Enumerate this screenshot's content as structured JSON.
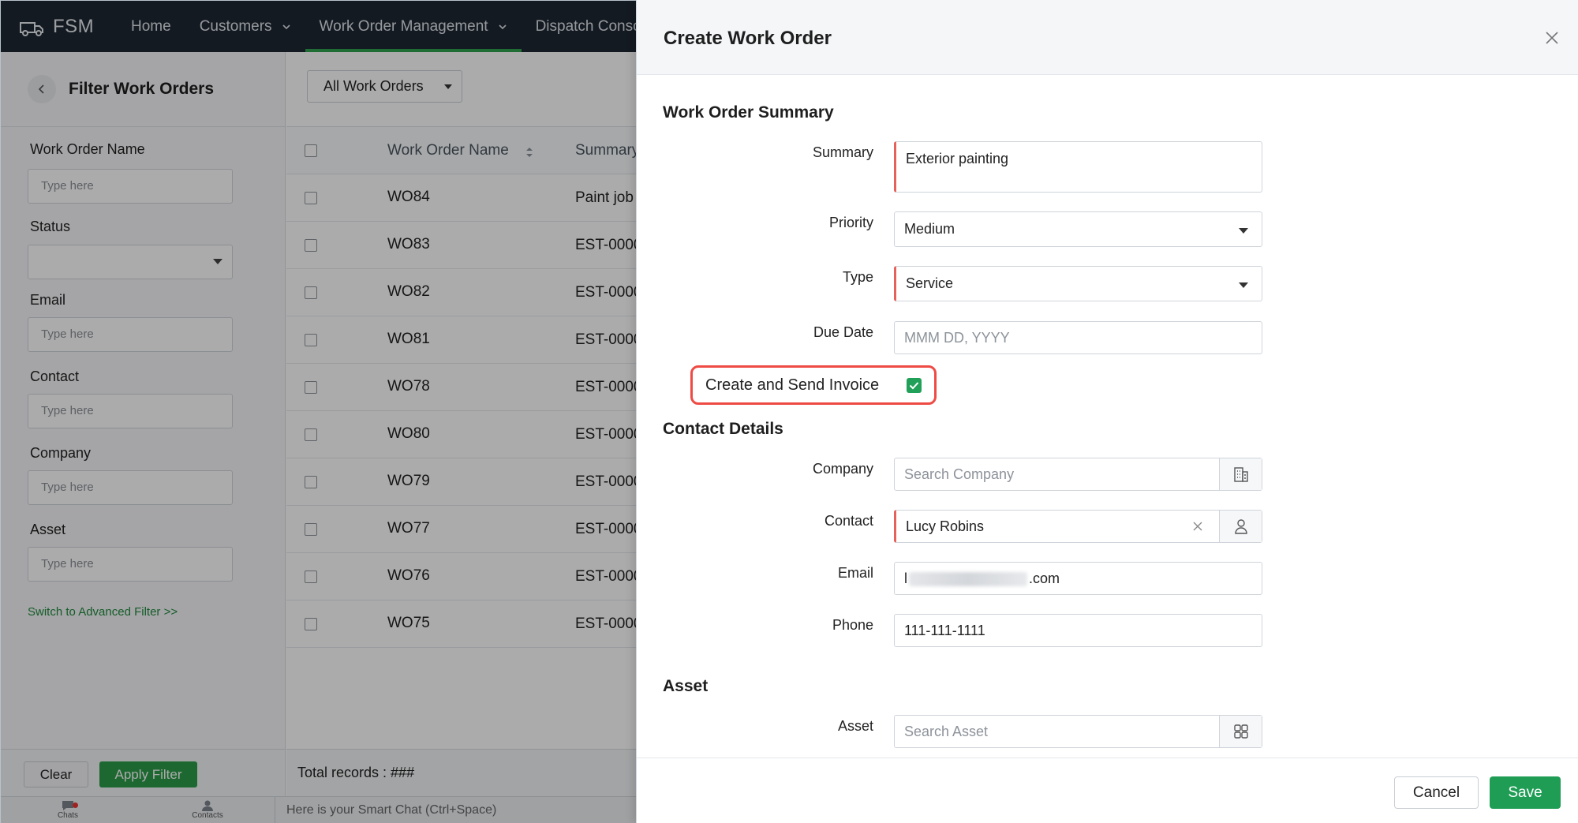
{
  "topnav": {
    "brand": "FSM",
    "items": [
      {
        "label": "Home"
      },
      {
        "label": "Customers"
      },
      {
        "label": "Work Order Management"
      },
      {
        "label": "Dispatch Console"
      }
    ]
  },
  "filter": {
    "title": "Filter Work Orders",
    "fields": [
      {
        "label": "Work Order Name",
        "placeholder": "Type here"
      },
      {
        "label": "Status",
        "value": ""
      },
      {
        "label": "Email",
        "placeholder": "Type here"
      },
      {
        "label": "Contact",
        "placeholder": "Type here"
      },
      {
        "label": "Company",
        "placeholder": "Type here"
      },
      {
        "label": "Asset",
        "placeholder": "Type here"
      }
    ],
    "advanced_link": "Switch to Advanced Filter >>",
    "clear_label": "Clear",
    "apply_label": "Apply Filter"
  },
  "list": {
    "view": "All Work Orders",
    "columns": [
      "Work Order Name",
      "Summary"
    ],
    "rows": [
      {
        "name": "WO84",
        "summary": "Paint job"
      },
      {
        "name": "WO83",
        "summary": "EST-0000"
      },
      {
        "name": "WO82",
        "summary": "EST-0000"
      },
      {
        "name": "WO81",
        "summary": "EST-0000"
      },
      {
        "name": "WO78",
        "summary": "EST-0000"
      },
      {
        "name": "WO80",
        "summary": "EST-0000"
      },
      {
        "name": "WO79",
        "summary": "EST-0000"
      },
      {
        "name": "WO77",
        "summary": "EST-0000"
      },
      {
        "name": "WO76",
        "summary": "EST-0000"
      },
      {
        "name": "WO75",
        "summary": "EST-0000"
      }
    ],
    "total_label": "Total records : ###"
  },
  "bottombar": {
    "chats_label": "Chats",
    "contacts_label": "Contacts",
    "smart_chat": "Here is your Smart Chat (Ctrl+Space)"
  },
  "modal": {
    "title": "Create Work Order",
    "summary_section": {
      "title": "Work Order Summary",
      "summary_label": "Summary",
      "summary_value": "Exterior painting",
      "priority_label": "Priority",
      "priority_value": "Medium",
      "type_label": "Type",
      "type_value": "Service",
      "due_label": "Due Date",
      "due_placeholder": "MMM DD, YYYY"
    },
    "invoice": {
      "label": "Create and Send Invoice",
      "checked": true
    },
    "contact_section": {
      "title": "Contact Details",
      "company_label": "Company",
      "company_placeholder": "Search Company",
      "contact_label": "Contact",
      "contact_value": "Lucy Robins",
      "email_label": "Email",
      "email_prefix": "l",
      "email_suffix": ".com",
      "phone_label": "Phone",
      "phone_value": "111-111-1111"
    },
    "asset_section": {
      "title": "Asset",
      "asset_label": "Asset",
      "asset_placeholder": "Search Asset"
    },
    "cancel_label": "Cancel",
    "save_label": "Save"
  },
  "colors": {
    "nav_bg": "#1f2733",
    "accent_green": "#1f9d55",
    "required_red": "#e5615a",
    "highlight_red": "#ef4b45"
  }
}
